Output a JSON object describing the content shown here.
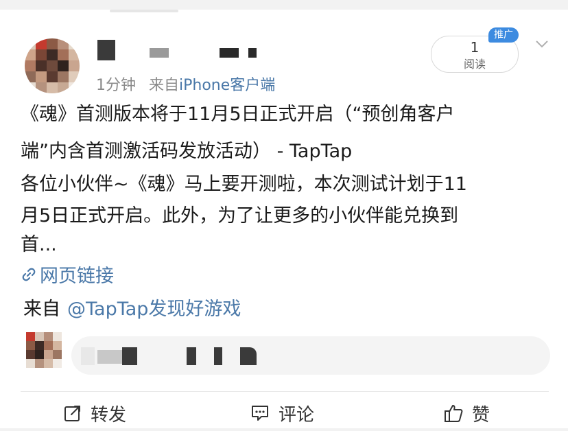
{
  "post": {
    "meta_time": "1分钟",
    "meta_source_prefix": "来自",
    "meta_source": "iPhone客户端",
    "read_count": "1",
    "read_label": "阅读",
    "promo_badge": "推广",
    "lines": [
      "《魂》首测版本将于11月5日正式开启（“预创角客户",
      "端”内含首测激活码发放活动） - TapTap",
      "各位小伙伴~《魂》马上要开测啦，本次测试计划于11",
      "月5日正式开启。此外，为了让更多的小伙伴能兑换到",
      "首..."
    ],
    "link_text": "网页链接",
    "from_prefix": "来自",
    "from_account": "@TapTap发现好游戏"
  },
  "actions": {
    "repost": "转发",
    "comment": "评论",
    "like": "赞"
  },
  "icons": {
    "link": "link-icon",
    "repost": "repost-icon",
    "comment": "comment-icon",
    "like": "thumbs-up-icon",
    "more": "chevron-down-icon"
  },
  "colors": {
    "link_blue": "#4a78a8",
    "promo_blue": "#3d8be0",
    "meta_gray": "#8a8a8a"
  }
}
